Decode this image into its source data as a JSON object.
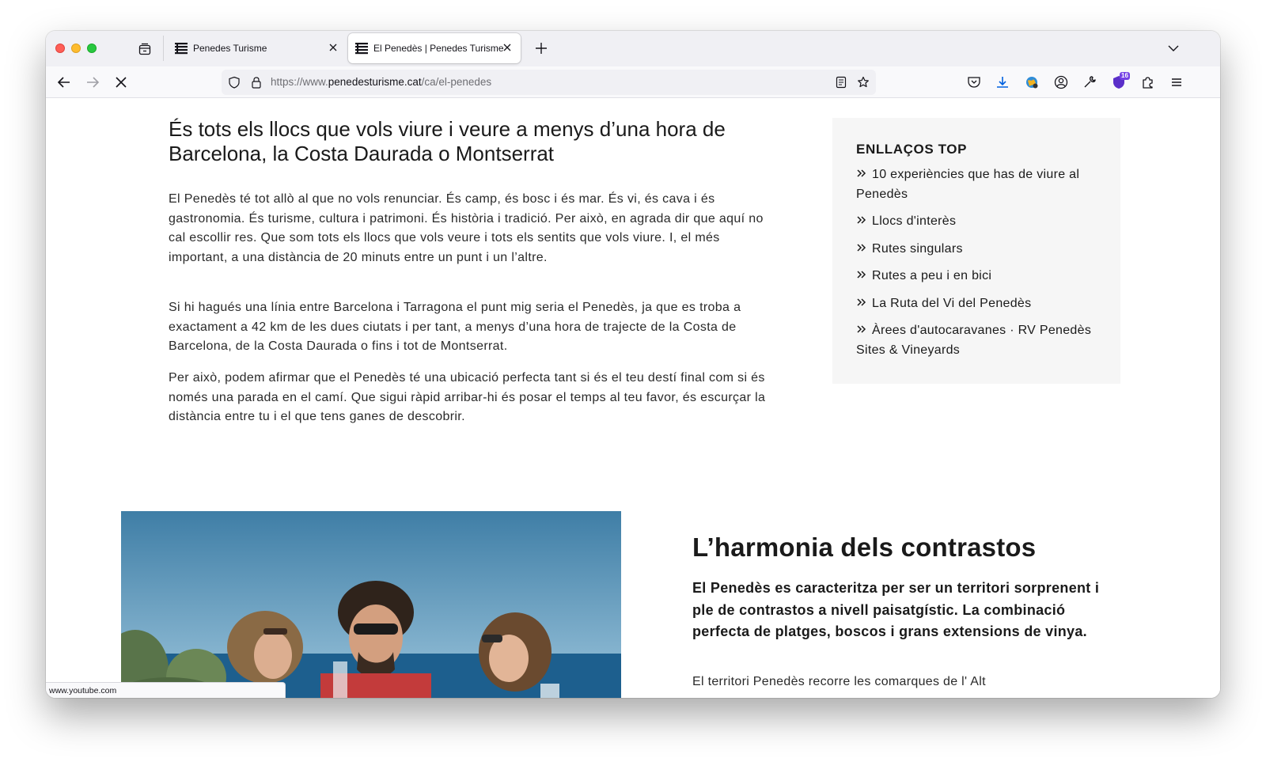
{
  "browser": {
    "tabs": [
      {
        "label": "Penedes Turisme",
        "active": false
      },
      {
        "label": "El Penedès | Penedes Turisme",
        "active": true
      }
    ],
    "url": {
      "prefix": "https://www.",
      "domain": "penedesturisme.cat",
      "path": "/ca/el-penedes"
    },
    "extension_badge": "16",
    "status_url": "www.youtube.com"
  },
  "article": {
    "heading": "És tots els llocs que vols viure i veure a menys d’una hora de Barcelona, la Costa Daurada o Montserrat",
    "paragraphs": [
      "El Penedès té tot allò al que no vols renunciar. És camp, és bosc i és mar. És vi, és cava i és gastronomia. És turisme, cultura i patrimoni. És història i tradició. Per això, en agrada dir que aquí no cal escollir res. Que som tots els llocs que vols veure i tots els sentits que vols viure. I, el més important, a una distància de 20 minuts entre un punt i un l’altre.",
      "Si hi hagués una línia entre Barcelona i Tarragona el punt mig seria el Penedès, ja que es troba a exactament a 42 km de les dues ciutats i per tant, a menys d’una hora de trajecte de la Costa de Barcelona, de la Costa Daurada o fins i tot de Montserrat.",
      "Per això, podem afirmar que el Penedès té una ubicació perfecta tant si és el teu destí final com si és només una parada en el camí. Que sigui ràpid arribar-hi és posar el temps al teu favor, és escurçar la distància entre tu i el que tens ganes de descobrir."
    ]
  },
  "sidebar": {
    "title": "ENLLAÇOS TOP",
    "links": [
      "10 experiències que has de viure al Penedès",
      "Llocs d'interès",
      "Rutes singulars",
      "Rutes a peu i en bici",
      "La Ruta del Vi del Penedès",
      "Àrees d'autocaravanes · RV Penedès Sites & Vineyards"
    ]
  },
  "section2": {
    "heading": "L’harmonia dels contrastos",
    "lead": "El Penedès es caracteritza per ser un territori sorprenent i ple de contrastos a nivell paisatgístic. La combinació perfecta de platges, boscos i grans extensions de vinya.",
    "body_start": "El territori Penedès recorre les comarques de l' Alt"
  },
  "colors": {
    "tabstrip": "#f0f0f4",
    "toolbar": "#f9f9fb",
    "sidebar_bg": "#f6f6f6",
    "text": "#1a1a1a",
    "accent_download": "#0060df",
    "extension": "#7542e5"
  }
}
